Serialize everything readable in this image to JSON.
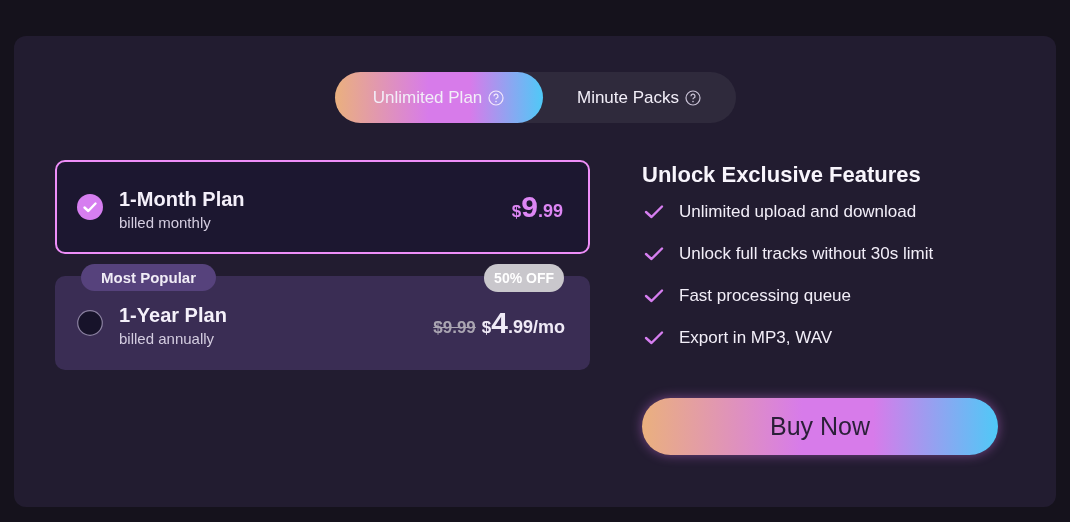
{
  "tabs": [
    {
      "label": "Unlimited Plan",
      "selected": true
    },
    {
      "label": "Minute Packs",
      "selected": false
    }
  ],
  "plans": [
    {
      "name": "1-Month Plan",
      "billing": "billed monthly",
      "selected": true,
      "price": {
        "currency": "$",
        "whole": "9",
        "cents": ".99"
      }
    },
    {
      "name": "1-Year Plan",
      "billing": "billed annually",
      "selected": false,
      "badge": "Most Popular",
      "discount": "50% OFF",
      "old_price": "$9.99",
      "price": {
        "currency": "$",
        "whole": "4",
        "cents": ".99",
        "suffix": "/mo"
      }
    }
  ],
  "features": {
    "title": "Unlock Exclusive Features",
    "items": [
      "Unlimited upload and download",
      "Unlock full tracks without 30s limit",
      "Fast processing queue",
      "Export in MP3, WAV"
    ]
  },
  "buy_button": "Buy Now"
}
